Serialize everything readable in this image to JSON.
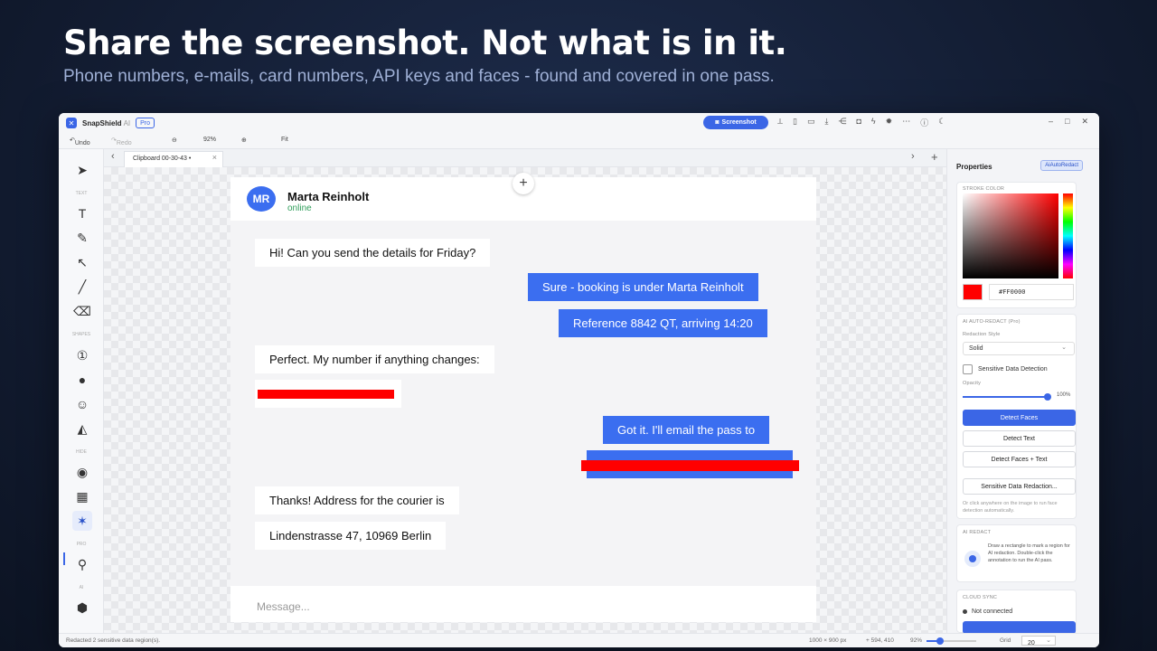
{
  "hero": {
    "title": "Share the screenshot. Not what is in it.",
    "subtitle": "Phone numbers, e-mails, card numbers, API keys and faces - found and covered in one pass."
  },
  "app": {
    "name": "SnapShield",
    "ai_suffix": "AI",
    "badge": "Pro",
    "screenshot_button": "Screenshot"
  },
  "toolbar": {
    "undo": "Undo",
    "redo": "Redo",
    "zoom": "92%",
    "fit": "Fit"
  },
  "tools": {
    "section_text": "TEXT",
    "section_shapes": "SHAPES",
    "section_hide": "HIDE",
    "section_pro": "PRO",
    "section_ai": "AI"
  },
  "tab": {
    "label": "Clipboard 00-30-43 •"
  },
  "chat": {
    "avatar_initials": "MR",
    "contact_name": "Marta Reinholt",
    "status": "online",
    "messages": [
      {
        "text": "Hi! Can you send the details for Friday?",
        "side": "in"
      },
      {
        "text": "Sure - booking is under Marta Reinholt",
        "side": "out"
      },
      {
        "text": "Reference 8842 QT, arriving 14:20",
        "side": "out"
      },
      {
        "text": "Perfect. My number if anything changes:",
        "side": "in"
      },
      {
        "text": "Got it. I'll email the pass to",
        "side": "out"
      },
      {
        "text": "Thanks! Address for the courier is",
        "side": "in"
      },
      {
        "text": "Lindenstrasse 47, 10969 Berlin",
        "side": "in"
      }
    ],
    "input_placeholder": "Message..."
  },
  "props": {
    "title": "Properties",
    "ai_badge": "AiAutoRedact",
    "stroke_label": "STROKE COLOR",
    "hex": "#FF0000",
    "auto_redact_label": "AI AUTO-REDACT (Pro)",
    "redaction_style_label": "Redaction Style",
    "redaction_style": "Solid",
    "sensitive_checkbox": "Sensitive Data Detection",
    "opacity_label": "Opacity",
    "opacity_value": "100%",
    "detect_faces": "Detect Faces",
    "detect_text": "Detect Text",
    "detect_faces_text": "Detect Faces + Text",
    "sensitive_redaction": "Sensitive Data Redaction...",
    "hint_click": "Or click anywhere on the image to run face detection automatically.",
    "ai_redact_label": "AI REDACT",
    "ai_redact_hint": "Draw a rectangle to mark a region for AI redaction. Double-click the annotation to run the AI pass.",
    "cloud_sync_label": "CLOUD SYNC",
    "cloud_status": "Not connected"
  },
  "statusbar": {
    "message": "Redacted 2 sensitive data region(s).",
    "dimensions": "1000 × 900 px",
    "cursor": "+ 594, 410",
    "zoom": "92%",
    "grid_label": "Grid",
    "grid_value": "20"
  },
  "colors": {
    "accent": "#3b66e6",
    "redaction": "#ff0000",
    "online": "#2f9e5a"
  }
}
